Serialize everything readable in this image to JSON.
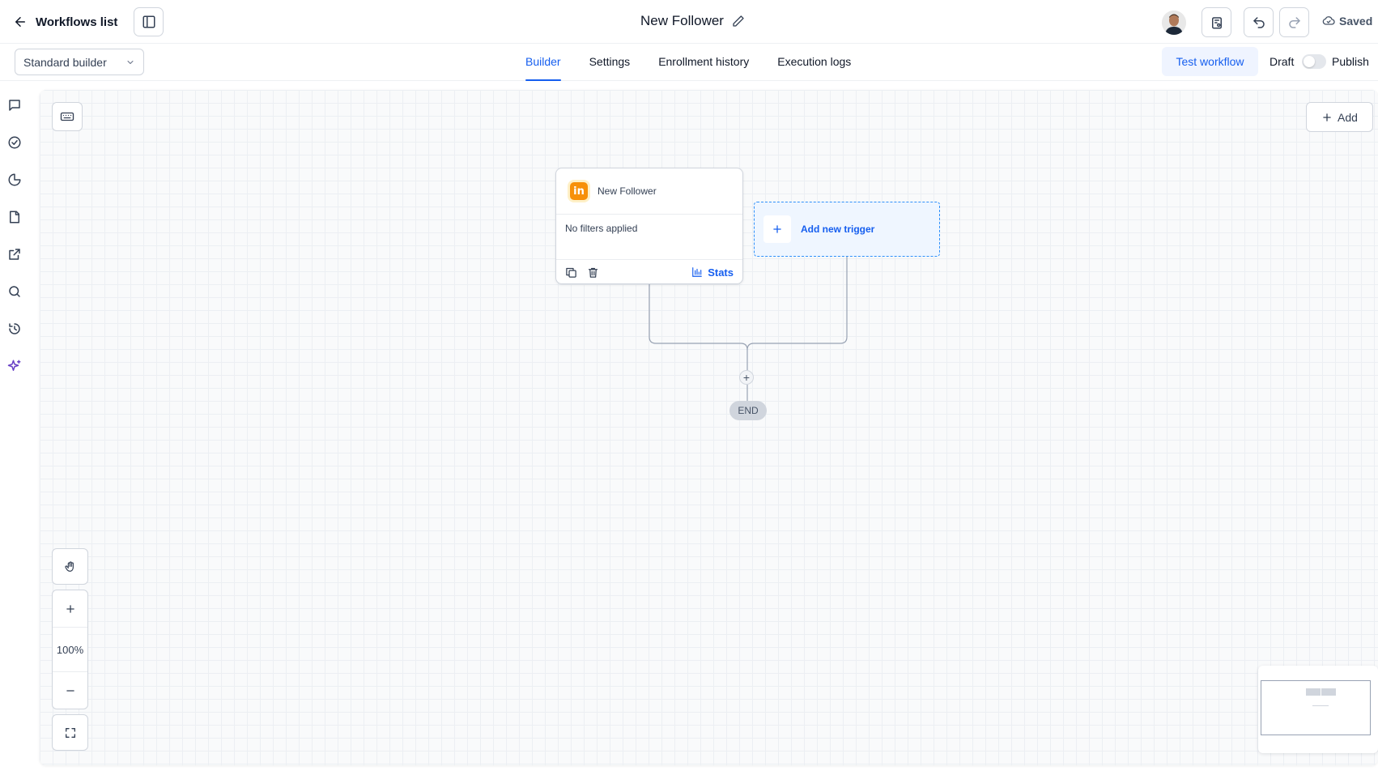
{
  "header": {
    "back_label": "Workflows list",
    "workflow_title": "New Follower",
    "save_status": "Saved"
  },
  "subheader": {
    "builder_mode": "Standard builder",
    "tabs": [
      {
        "label": "Builder",
        "active": true
      },
      {
        "label": "Settings",
        "active": false
      },
      {
        "label": "Enrollment history",
        "active": false
      },
      {
        "label": "Execution logs",
        "active": false
      }
    ],
    "test_button": "Test workflow",
    "draft_label": "Draft",
    "publish_label": "Publish",
    "published": false
  },
  "rail": {
    "icons": [
      "message-icon",
      "check-circle-icon",
      "pie-chart-icon",
      "file-icon",
      "external-link-icon",
      "search-icon",
      "history-icon",
      "sparkles-icon"
    ]
  },
  "canvas": {
    "add_label": "Add",
    "trigger_node": {
      "icon": "linkedin-icon",
      "title": "New Follower",
      "filters": "No filters applied",
      "stats_label": "Stats"
    },
    "add_trigger_label": "Add new trigger",
    "plus_symbol": "+",
    "end_label": "END",
    "zoom_level": "100%"
  },
  "colors": {
    "accent": "#155eef",
    "trigger_bg": "#eff6ff",
    "trigger_border": "#2e90fa",
    "linkedin_badge": "#f79009",
    "sparkle": "#6941c6"
  }
}
